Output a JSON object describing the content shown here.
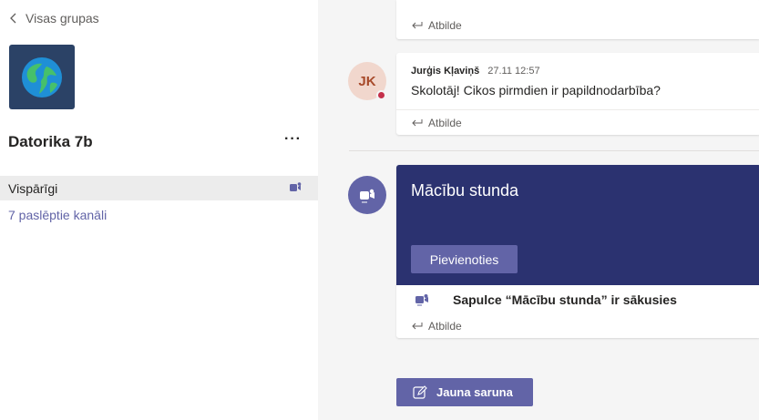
{
  "sidebar": {
    "back_label": "Visas grupas",
    "team_name": "Datorika 7b",
    "more_label": "···",
    "channel_label": "Vispārīgi",
    "hidden_channels_label": "7 paslēptie kanāli"
  },
  "posts": {
    "reply_label": "Atbilde",
    "message": {
      "avatar_initials": "JK",
      "author": "Jurģis Kļaviņš",
      "timestamp": "27.11 12:57",
      "text": "Skolotāj! Cikos pirmdien ir papildnodarbība?"
    },
    "meeting": {
      "title": "Mācību stunda",
      "join_label": "Pievienoties",
      "started_text": "Sapulce “Mācību stunda” ir sākusies"
    }
  },
  "compose": {
    "new_conversation_label": "Jauna saruna"
  },
  "colors": {
    "brand": "#6264a7",
    "meeting_banner": "#2b3270",
    "status_busy": "#c4314b"
  }
}
